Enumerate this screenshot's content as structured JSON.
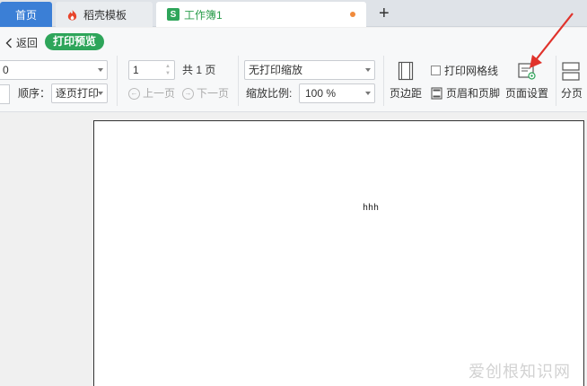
{
  "tabs": {
    "home": "首页",
    "template": "稻壳模板",
    "workbook": "工作簿1",
    "new_tab": "+"
  },
  "toolbar": {
    "back": "返回",
    "print_preview": "打印预览",
    "order_label": "顺序：",
    "order_value": "逐页打印",
    "page_input": "1",
    "total_pages": "共 1 页",
    "prev_page": "上一页",
    "next_page": "下一页",
    "scaling_value": "无打印缩放",
    "zoom_label": "缩放比例:",
    "zoom_value": "100 %",
    "margins": "页边距",
    "gridlines": "打印网格线",
    "header_footer": "页眉和页脚",
    "page_setup": "页面设置",
    "page_break": "分页",
    "first_select_value": "0"
  },
  "sheet": {
    "cell_text": "hhh"
  },
  "watermark": "爱创根知识网",
  "colors": {
    "accent_green": "#2ea55a",
    "home_tab_blue": "#3b7fd6",
    "annotation_red": "#e0322b",
    "unsaved_dot": "#f08a3c"
  }
}
